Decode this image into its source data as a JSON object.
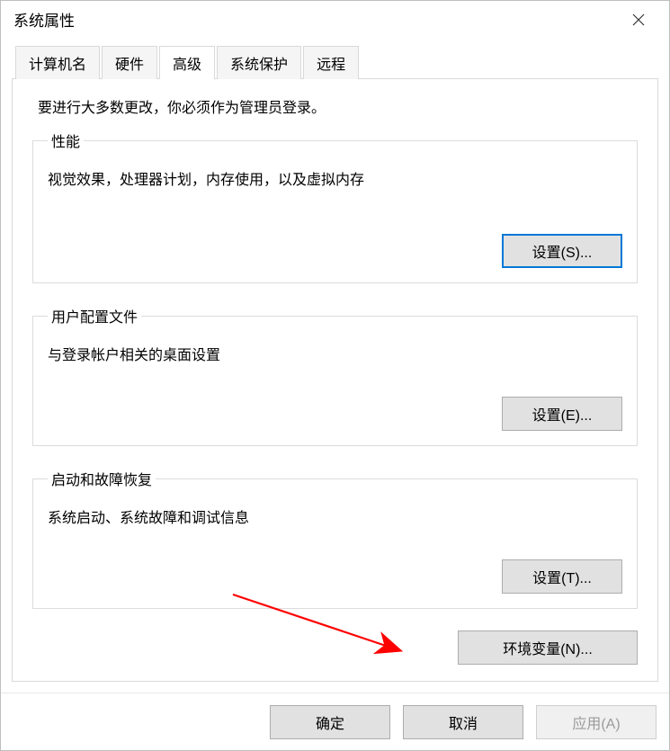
{
  "window": {
    "title": "系统属性"
  },
  "tabs": {
    "computer_name": "计算机名",
    "hardware": "硬件",
    "advanced": "高级",
    "system_protection": "系统保护",
    "remote": "远程"
  },
  "admin_note": "要进行大多数更改，你必须作为管理员登录。",
  "performance": {
    "legend": "性能",
    "desc": "视觉效果，处理器计划，内存使用，以及虚拟内存",
    "button": "设置(S)..."
  },
  "profiles": {
    "legend": "用户配置文件",
    "desc": "与登录帐户相关的桌面设置",
    "button": "设置(E)..."
  },
  "startup": {
    "legend": "启动和故障恢复",
    "desc": "系统启动、系统故障和调试信息",
    "button": "设置(T)..."
  },
  "env_button": "环境变量(N)...",
  "buttons": {
    "ok": "确定",
    "cancel": "取消",
    "apply": "应用(A)"
  }
}
